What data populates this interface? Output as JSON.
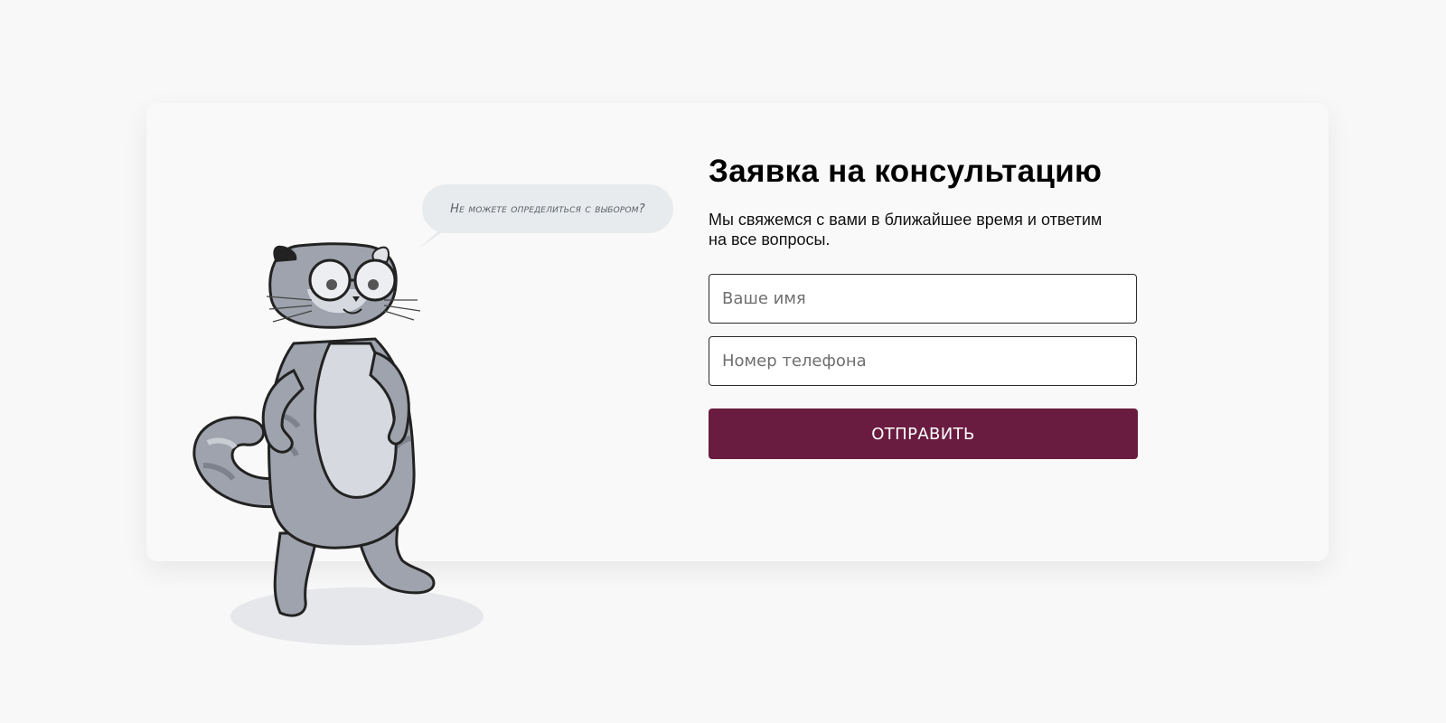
{
  "speech_bubble": {
    "text": "Не можете определиться с выбором?"
  },
  "form": {
    "title": "Заявка на консультацию",
    "subtitle": "Мы свяжемся с вами в ближайшее время и ответим на все вопросы.",
    "name_placeholder": "Ваше имя",
    "phone_placeholder": "Номер телефона",
    "submit_label": "ОТПРАВИТЬ"
  },
  "colors": {
    "page_background": "#f8f8f8",
    "card_background": "#f9f9f9",
    "button": "#6a1c40",
    "bubble": "#e8ebed",
    "mascot_fur": "#9ea3ad",
    "mascot_belly": "#d6d9e0"
  },
  "mascot": {
    "icon": "cat-mascot-illustration"
  }
}
